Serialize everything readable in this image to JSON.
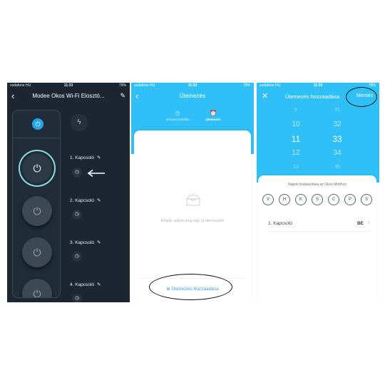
{
  "phone1": {
    "status": {
      "carrier": "vodafone HU",
      "time": "11:33",
      "battery": "79%"
    },
    "header": {
      "title": "Modee Okos Wi-Fi Elosztó..."
    },
    "switches": [
      {
        "label": "1. Kapcsoló"
      },
      {
        "label": "2. Kapcsoló"
      },
      {
        "label": "3. Kapcsoló"
      },
      {
        "label": "4. Kapcsoló"
      }
    ],
    "icons": {
      "back": "chevron-left-icon",
      "edit": "pencil-icon",
      "master": "power-icon",
      "bolt": "bolt-icon",
      "schedule": "clock-icon"
    },
    "colors": {
      "background": "#1b2631",
      "accent": "#23a6e8",
      "ring": "#88dde5"
    }
  },
  "phone2": {
    "status": {
      "carrier": "vodafone HU",
      "time": "11:33",
      "battery": "79%"
    },
    "header": {
      "title": "Ütemezés"
    },
    "tabs": [
      {
        "label": "Visszaszámlálás",
        "active": false
      },
      {
        "label": "Ütemezés",
        "active": true
      }
    ],
    "empty_text": "Kérjük, adjon meg egy új ütemezést!",
    "add_button": "Ütemezés hozzáadása",
    "colors": {
      "header": "#2ec0f7",
      "link": "#2ba7e8"
    }
  },
  "phone3": {
    "status": {
      "carrier": "vodafone HU",
      "time": "11:33",
      "battery": "78%"
    },
    "header": {
      "title": "Ütemezés hozzáadása",
      "save": "Mentés"
    },
    "picker": {
      "hours": [
        "9",
        "10",
        "11",
        "12",
        "13"
      ],
      "minutes": [
        "31",
        "32",
        "33",
        "34",
        "35"
      ],
      "selected_hour": "11",
      "selected_minute": "33"
    },
    "days_title": "Napok kiválasztása az Okos Módhoz",
    "days": [
      "V",
      "H",
      "K",
      "S",
      "C",
      "P",
      "S"
    ],
    "switch_row": {
      "label": "1. Kapcsoló",
      "value": "BE"
    }
  }
}
